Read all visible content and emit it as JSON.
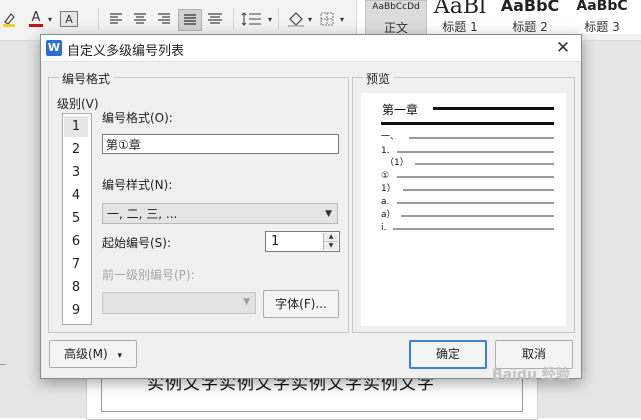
{
  "ribbon": {
    "icons": [
      "highlight-icon",
      "font-color-icon",
      "char-shading-icon",
      "align-left-icon",
      "align-center-icon",
      "align-right-icon",
      "justify-icon",
      "distribute-icon",
      "line-spacing-icon",
      "shading-icon",
      "border-icon"
    ],
    "font_color_glyph": "A",
    "shading_glyph": "A",
    "styles": [
      {
        "preview": "AaBbCcDd",
        "name": "正文",
        "selected": true
      },
      {
        "preview": "AaBl",
        "name": "标题 1",
        "selected": false
      },
      {
        "preview": "AaBbC",
        "name": "标题 2",
        "selected": false
      },
      {
        "preview": "AaBbC",
        "name": "标题 3",
        "selected": false
      }
    ]
  },
  "document": {
    "page_text": "实例文字实例文字实例文字实例文字"
  },
  "dialog": {
    "app_icon": "W",
    "title": "自定义多级编号列表",
    "close_glyph": "✕",
    "format_group_label": "编号格式",
    "level_label": "级别(V)",
    "levels": [
      "1",
      "2",
      "3",
      "4",
      "5",
      "6",
      "7",
      "8",
      "9"
    ],
    "selected_level": "1",
    "number_format_label": "编号格式(O):",
    "number_format_value": "第①章",
    "number_style_label": "编号样式(N):",
    "number_style_value": "一, 二, 三, ...",
    "start_at_label": "起始编号(S):",
    "start_at_value": "1",
    "prev_level_label": "前一级别编号(P):",
    "font_button": "字体(F)...",
    "preview_group_label": "预览",
    "preview": {
      "title": "第一章",
      "rows": [
        "一、",
        "1.",
        "（1）",
        "①",
        "1）",
        "a.",
        "a）",
        "i."
      ]
    },
    "advanced_button": "高级(M)",
    "advanced_glyph": "▾",
    "ok_button": "确定",
    "cancel_button": "取消"
  },
  "watermark": "Baidu 经验"
}
